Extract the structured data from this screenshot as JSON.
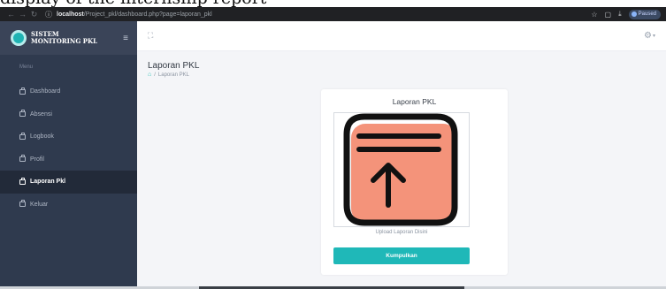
{
  "caption": "display of the internship report",
  "browser": {
    "url_host": "localhost",
    "url_path": "/Project_pkl/dashboard.php?page=laporan_pkl",
    "paused_label": "Paused"
  },
  "brand": {
    "line1": "SISTEM",
    "line2": "MONITORING PKL"
  },
  "sidebar": {
    "menu_heading": "Menu",
    "items": [
      {
        "label": "Dashboard",
        "active": false
      },
      {
        "label": "Absensi",
        "active": false
      },
      {
        "label": "Logbook",
        "active": false
      },
      {
        "label": "Profil",
        "active": false
      },
      {
        "label": "Laporan Pkl",
        "active": true
      },
      {
        "label": "Keluar",
        "active": false
      }
    ]
  },
  "page": {
    "title": "Laporan PKL",
    "breadcrumb": {
      "separator": "/",
      "current": "Laporan PKL"
    }
  },
  "card": {
    "title": "Laporan PKL",
    "upload_hint": "Upload Laporan Disini",
    "submit_label": "Kumpulkan"
  },
  "colors": {
    "sidebar_bg": "#2f3a4e",
    "accent": "#1fb8b8",
    "upload_icon_fill": "#f4937a"
  },
  "icons": {
    "home": "home-icon",
    "upload": "upload-file-icon",
    "settings": "gear-icon",
    "fullscreen": "expand-icon"
  }
}
